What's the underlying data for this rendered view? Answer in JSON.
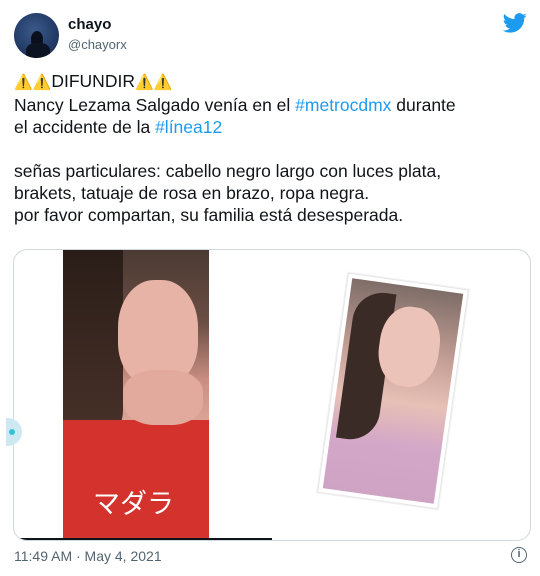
{
  "user": {
    "name": "chayo",
    "handle": "@chayorx"
  },
  "tweet": {
    "line1_warn": "⚠️⚠️",
    "line1_word": "DIFUNDIR",
    "line1_warn_end": "⚠️⚠️",
    "line2_a": "Nancy Lezama Salgado venía en el ",
    "hashtag1": "#metrocdmx",
    "line2_b": " durante",
    "line3_a": "el accidente de la ",
    "hashtag2": "#línea12",
    "line4": "señas particulares: cabello negro largo con luces plata,",
    "line5": "brakets, tatuaje de rosa en brazo, ropa negra.",
    "line6": "por favor compartan, su familia está desesperada."
  },
  "media": {
    "caption": "マダラ"
  },
  "meta": {
    "timestamp": "11:49 AM · May 4, 2021",
    "info_icon_text": "i"
  },
  "colors": {
    "link": "#1d9bf0",
    "bird": "#1d9bf0",
    "secondary": "#536471"
  },
  "icons": {
    "brand": "twitter-bird-icon",
    "info": "info-icon"
  }
}
